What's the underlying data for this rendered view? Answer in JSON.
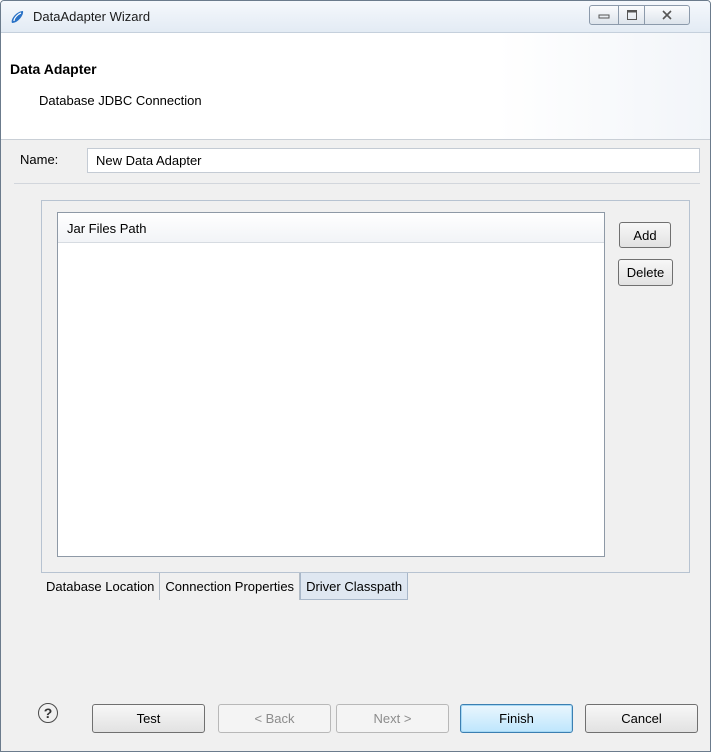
{
  "window": {
    "title": "DataAdapter Wizard",
    "controls": [
      "minimize-icon",
      "maximize-icon",
      "close-icon"
    ]
  },
  "header": {
    "title": "Data Adapter",
    "subtitle": "Database JDBC Connection"
  },
  "name_field": {
    "label": "Name:",
    "value": "New Data Adapter"
  },
  "classpath_list": {
    "column_header": "Jar Files Path",
    "rows": []
  },
  "side_buttons": {
    "add": "Add",
    "delete": "Delete"
  },
  "tabs": [
    {
      "label": "Database Location",
      "active": false
    },
    {
      "label": "Connection Properties",
      "active": false
    },
    {
      "label": "Driver Classpath",
      "active": true
    }
  ],
  "footer": {
    "help_icon": "help-icon",
    "help_glyph": "?",
    "test": "Test",
    "back": "< Back",
    "next": "Next >",
    "finish": "Finish",
    "cancel": "Cancel"
  },
  "colors": {
    "window_bg": "#f0f0f0",
    "accent_default_button": "#3c7fb1",
    "active_tab_bg": "#dfe7f1"
  }
}
